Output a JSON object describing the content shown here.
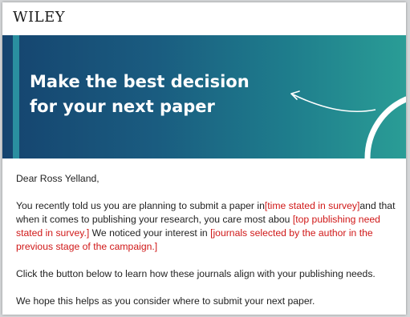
{
  "header": {
    "logo_text": "WILEY"
  },
  "banner": {
    "title_line1": "Make the best decision",
    "title_line2": "for your next paper",
    "colors": {
      "gradient_start": "#15446f",
      "gradient_end": "#2a9d96",
      "accent_bar": "#2a8fa0"
    },
    "icon": "arrow-arc-icon"
  },
  "email": {
    "greeting": "Dear Ross Yelland,",
    "paragraph1": {
      "l1_a": "You recently told us you are planning to submit a paper in",
      "l1_ph": "[time stated in survey]",
      "l1_b": "and that",
      "l2_a": "when it comes to publishing your research, you care most abou",
      "l2_ph": " [top publishing need",
      "l3_ph": "stated in survey.]",
      "l3_b": " We noticed your interest in ",
      "l3_ph2": "[journals selected by the author in the",
      "l4_ph": "previous stage of the campaign.]"
    },
    "paragraph2": "Click the button below to learn how these journals align with  your publishing needs.",
    "paragraph3": "We hope this helps as you consider where to submit your next paper.",
    "placeholder_color": "#d01818"
  }
}
